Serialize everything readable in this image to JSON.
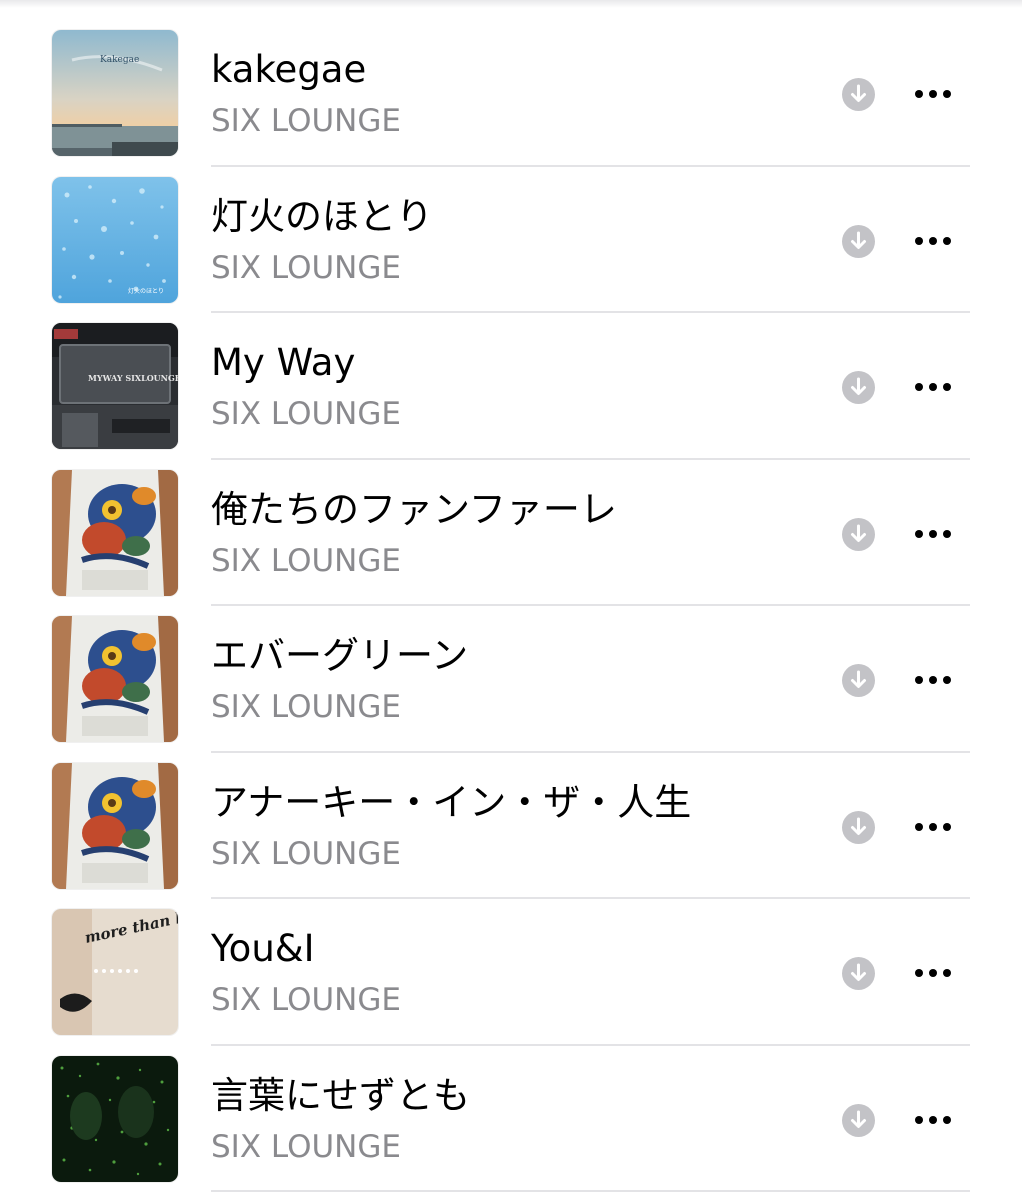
{
  "songs": [
    {
      "title": "kakegae",
      "artist": "SIX LOUNGE",
      "artwork": "sea-sunset-cover",
      "art_text": "Kakegae"
    },
    {
      "title": "灯火のほとり",
      "artist": "SIX LOUNGE",
      "artwork": "blue-bubbles-cover",
      "art_text": "灯火のほとり"
    },
    {
      "title": "My Way",
      "artist": "SIX LOUNGE",
      "artwork": "equipment-case-cover",
      "art_text": "MYWAY SIXLOUNGE"
    },
    {
      "title": "俺たちのファンファーレ",
      "artist": "SIX LOUNGE",
      "artwork": "floral-jacket-cover",
      "art_text": ""
    },
    {
      "title": "エバーグリーン",
      "artist": "SIX LOUNGE",
      "artwork": "floral-jacket-cover",
      "art_text": ""
    },
    {
      "title": "アナーキー・イン・ザ・人生",
      "artist": "SIX LOUNGE",
      "artwork": "floral-jacket-cover",
      "art_text": ""
    },
    {
      "title": "You&I",
      "artist": "SIX LOUNGE",
      "artwork": "lips-more-than-love-cover",
      "art_text": "more than love"
    },
    {
      "title": "言葉にせずとも",
      "artist": "SIX LOUNGE",
      "artwork": "green-glitter-cover",
      "art_text": ""
    }
  ],
  "icons": {
    "download": "download-arrow-circle-icon",
    "more": "ellipsis-icon"
  },
  "colors": {
    "title": "#000000",
    "artist": "#8a8a8e",
    "download_circle": "#c3c3c7",
    "separator": "#e3e3e6"
  }
}
